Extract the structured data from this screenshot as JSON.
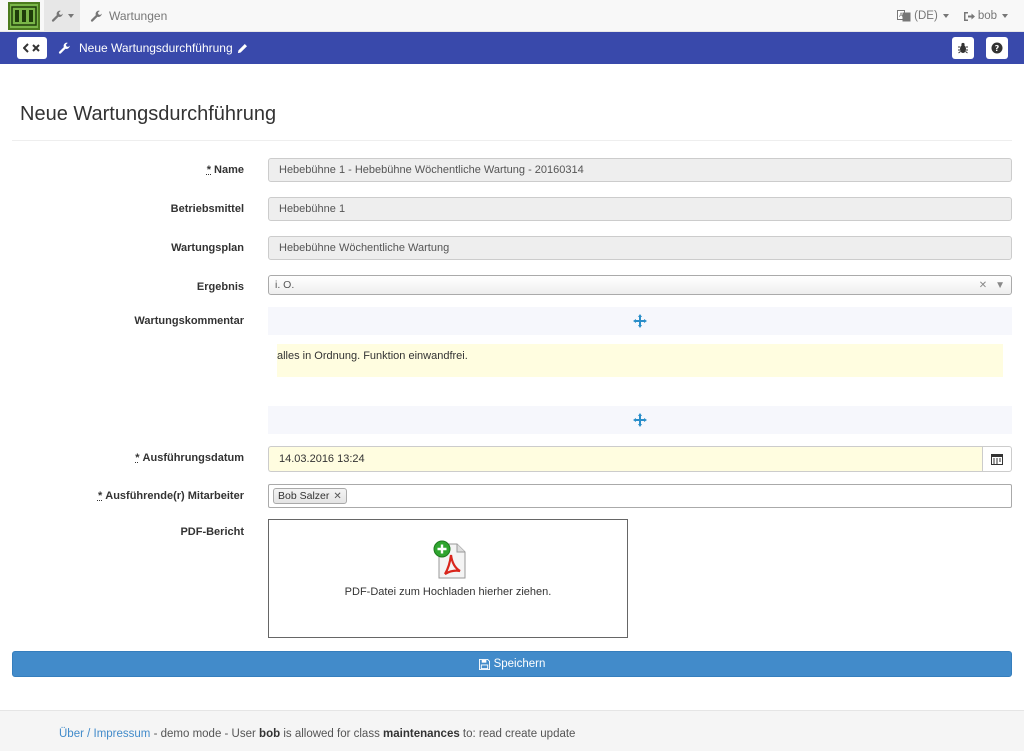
{
  "topbar": {
    "breadcrumb": "Wartungen",
    "language": "(DE)",
    "user": "bob"
  },
  "subbar": {
    "title": "Neue Wartungsdurchführung"
  },
  "page": {
    "title": "Neue Wartungsdurchführung"
  },
  "form": {
    "name_label": "Name",
    "name_value": "Hebebühne 1 - Hebebühne Wöchentliche Wartung - 20160314",
    "asset_label": "Betriebsmittel",
    "asset_value": "Hebebühne 1",
    "plan_label": "Wartungsplan",
    "plan_value": "Hebebühne Wöchentliche Wartung",
    "result_label": "Ergebnis",
    "result_value": "i. O.",
    "comment_label": "Wartungskommentar",
    "comment_value": "alles in Ordnung. Funktion einwandfrei.",
    "date_label": "Ausführungsdatum",
    "date_value": "14.03.2016 13:24",
    "staff_label": "Ausführende(r) Mitarbeiter",
    "staff_tags": [
      "Bob Salzer"
    ],
    "pdf_label": "PDF-Bericht",
    "pdf_hint": "PDF-Datei zum Hochladen hierher ziehen.",
    "required_marker": "*"
  },
  "save_label": "Speichern",
  "footer": {
    "link": "Über / Impressum",
    "text1": " - demo mode - User ",
    "user": "bob",
    "text2": " is allowed for class ",
    "class_name": "maintenances",
    "text3": " to: read create update"
  },
  "colors": {
    "subbar": "#3949ab",
    "primary": "#428bca",
    "highlight": "#fffde0",
    "logo": "#7ab648"
  }
}
